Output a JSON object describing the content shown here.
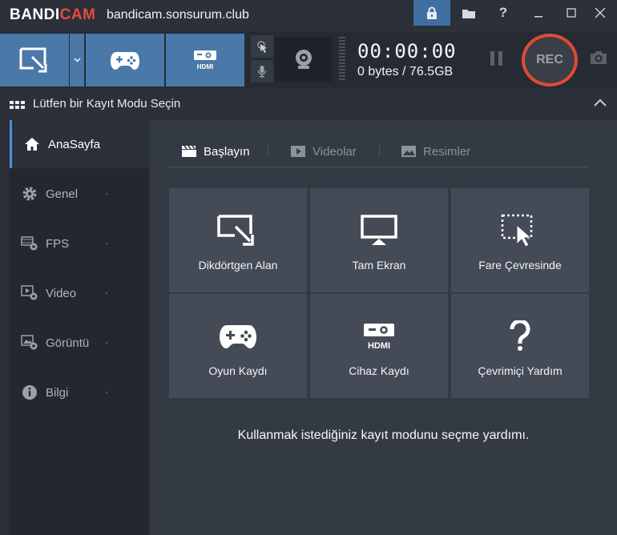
{
  "titlebar": {
    "logo_bandi": "BANDI",
    "logo_cam": "CAM",
    "site": "bandicam.sonsurum.club",
    "icons": [
      "lock-icon",
      "folder-icon",
      "help-icon",
      "minimize-icon",
      "maximize-icon",
      "close-icon"
    ],
    "help_label": "?"
  },
  "toolbar": {
    "modes": [
      "rectangle-mode",
      "game-mode",
      "device-mode"
    ],
    "timer": "00:00:00",
    "size": "0 bytes / 76.5GB",
    "rec_label": "REC"
  },
  "section": {
    "title": "Lütfen bir Kayıt Modu Seçin"
  },
  "sidebar": {
    "items": [
      {
        "label": "AnaSayfa",
        "icon": "home-icon",
        "active": true
      },
      {
        "label": "Genel",
        "icon": "gear-icon"
      },
      {
        "label": "FPS",
        "icon": "fps-icon"
      },
      {
        "label": "Video",
        "icon": "video-settings-icon"
      },
      {
        "label": "Görüntü",
        "icon": "image-settings-icon"
      },
      {
        "label": "Bilgi",
        "icon": "info-icon"
      }
    ]
  },
  "tabs": [
    {
      "label": "Başlayın",
      "icon": "clapper-icon",
      "active": true
    },
    {
      "label": "Videolar",
      "icon": "play-icon"
    },
    {
      "label": "Resimler",
      "icon": "image-icon"
    }
  ],
  "tiles": [
    {
      "label": "Dikdörtgen Alan",
      "icon": "rectangle-area-icon"
    },
    {
      "label": "Tam Ekran",
      "icon": "fullscreen-icon"
    },
    {
      "label": "Fare Çevresinde",
      "icon": "around-mouse-icon"
    },
    {
      "label": "Oyun Kaydı",
      "icon": "gamepad-icon"
    },
    {
      "label": "Cihaz Kaydı",
      "icon": "hdmi-icon"
    },
    {
      "label": "Çevrimiçi Yardım",
      "icon": "question-icon"
    }
  ],
  "help_text": "Kullanmak istediğiniz kayıt modunu seçme yardımı.",
  "colors": {
    "accent": "#4a78a8",
    "rec_ring": "#e04a35",
    "active_indicator": "#4a90d9"
  }
}
